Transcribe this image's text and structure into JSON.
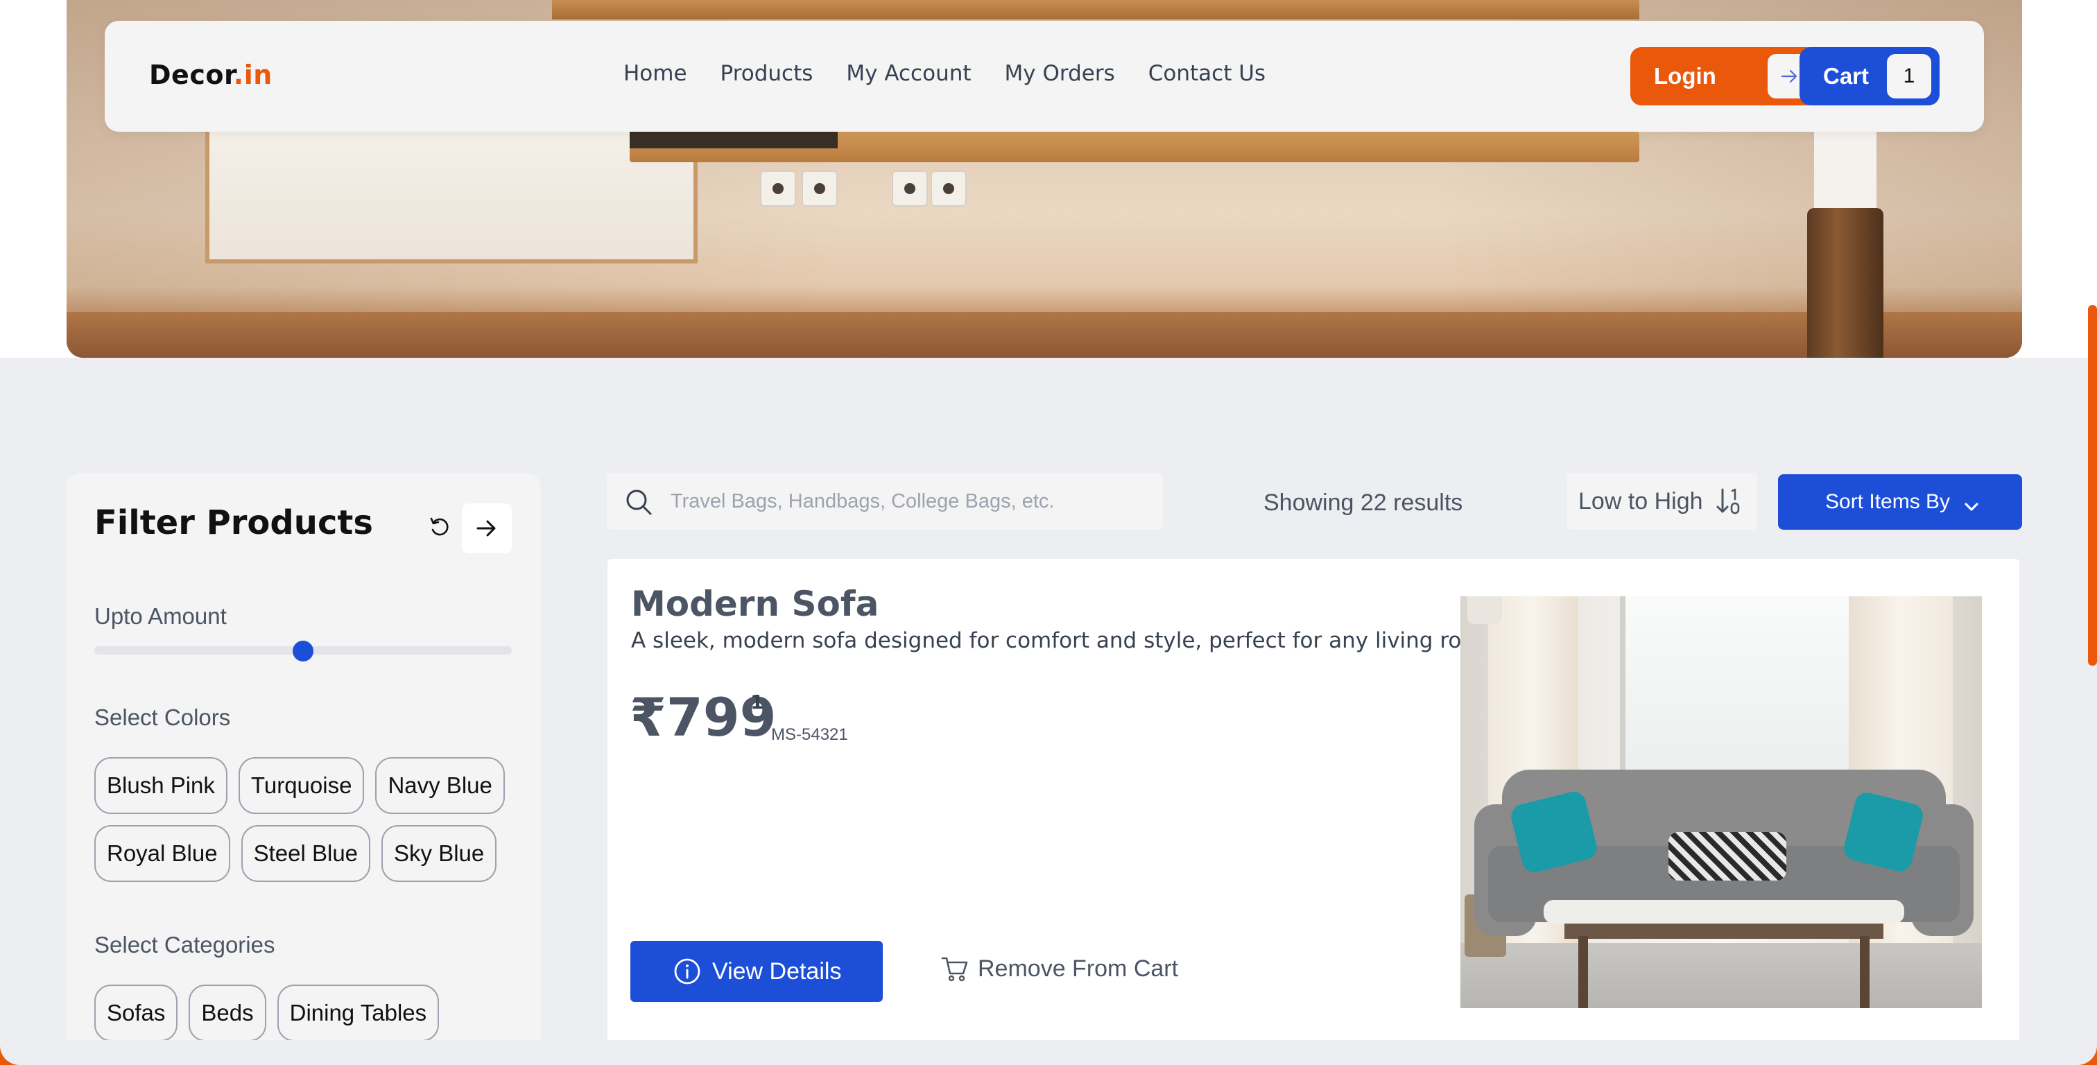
{
  "brand": {
    "name": "Decor",
    "suffix": ".in"
  },
  "nav": {
    "links": [
      "Home",
      "Products",
      "My Account",
      "My Orders",
      "Contact Us"
    ],
    "login_label": "Login",
    "cart_label": "Cart",
    "cart_count": "1"
  },
  "filter": {
    "title": "Filter Products",
    "amount_label": "Upto Amount",
    "amount_fraction": 0.5,
    "colors_label": "Select Colors",
    "colors": [
      "Blush Pink",
      "Turquoise",
      "Navy Blue",
      "Royal Blue",
      "Steel Blue",
      "Sky Blue"
    ],
    "categories_label": "Select Categories",
    "categories": [
      "Sofas",
      "Beds",
      "Dining Tables"
    ]
  },
  "toolbar": {
    "search_placeholder": "Travel Bags, Handbags, College Bags, etc.",
    "results_text": "Showing 22 results",
    "sort_order": "Low to High",
    "sort_button": "Sort Items By"
  },
  "product": {
    "title": "Modern Sofa",
    "description": "A sleek, modern sofa designed for comfort and style, perfect for any living room.",
    "price": "₹799",
    "price_sup": "1",
    "sku": "MS-54321",
    "view_label": "View Details",
    "remove_label": "Remove From Cart"
  },
  "colors": {
    "accent_orange": "#ea580c",
    "accent_blue": "#1d4ed8",
    "page_bg": "#eceef1"
  }
}
